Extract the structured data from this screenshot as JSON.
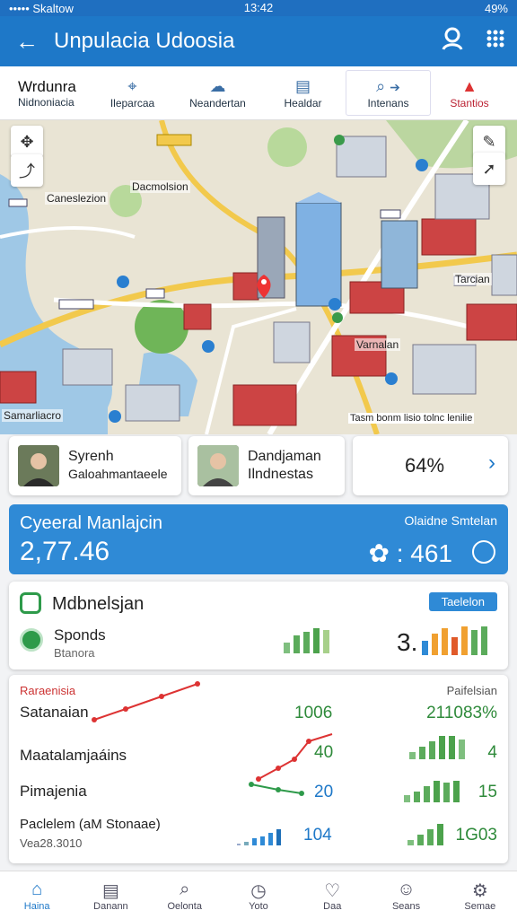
{
  "status": {
    "carrier": "••••• Skaltow",
    "time": "13:42",
    "battery": "49%"
  },
  "appbar": {
    "title": "Unpulacia Udoosia"
  },
  "tabs": [
    {
      "t1": "Wrdunra",
      "t2": "Nidnoniacia"
    },
    {
      "label": "Ileparcaa"
    },
    {
      "label": "Neandertan"
    },
    {
      "label": "Healdar"
    },
    {
      "label": "Intenans"
    },
    {
      "label": "Stantios"
    }
  ],
  "map": {
    "labels": [
      "Caneslezion",
      "Dacmolsion",
      "Samarliacro",
      "Varnalan",
      "Tarcian",
      "Tasm bonm lisio tolnc lenilie"
    ]
  },
  "cards": [
    {
      "name": "Syrenh",
      "sub": "Galoahmantaeele"
    },
    {
      "name": "Dandjaman",
      "sub": "Ilndnestas"
    },
    {
      "value": "64%"
    }
  ],
  "summary": {
    "title": "Cyeeral Manlajcin",
    "value": "2,77.46",
    "right_label": "Olaidne Smtelan",
    "right_value": "461"
  },
  "panel1": {
    "title": "Mdbnelsjan",
    "badge": "Taelelon",
    "row": "Sponds",
    "row_sub": "Btanora",
    "value": "3."
  },
  "panel2": {
    "header_left": "Raraenisia",
    "header_right": "Paifelsian",
    "rows": [
      {
        "label": "Satanaian",
        "mid": "1006",
        "right": "211083%"
      },
      {
        "label": "Maatalamjaáins",
        "mid": "40",
        "right": "4"
      },
      {
        "label": "Pimajenia",
        "mid": "20",
        "right": "15"
      },
      {
        "label": "Paclelem (aM Stonaae)",
        "sub": "Vea28.3010",
        "mid": "104",
        "right": "1G03"
      }
    ]
  },
  "nav": [
    {
      "label": "Haina",
      "icon": "home-icon"
    },
    {
      "label": "Danann",
      "icon": "document-icon"
    },
    {
      "label": "Oelonta",
      "icon": "search-icon"
    },
    {
      "label": "Yoto",
      "icon": "clock-icon"
    },
    {
      "label": "Daa",
      "icon": "heart-icon"
    },
    {
      "label": "Seans",
      "icon": "person-icon"
    },
    {
      "label": "Semae",
      "icon": "settings-icon"
    }
  ]
}
